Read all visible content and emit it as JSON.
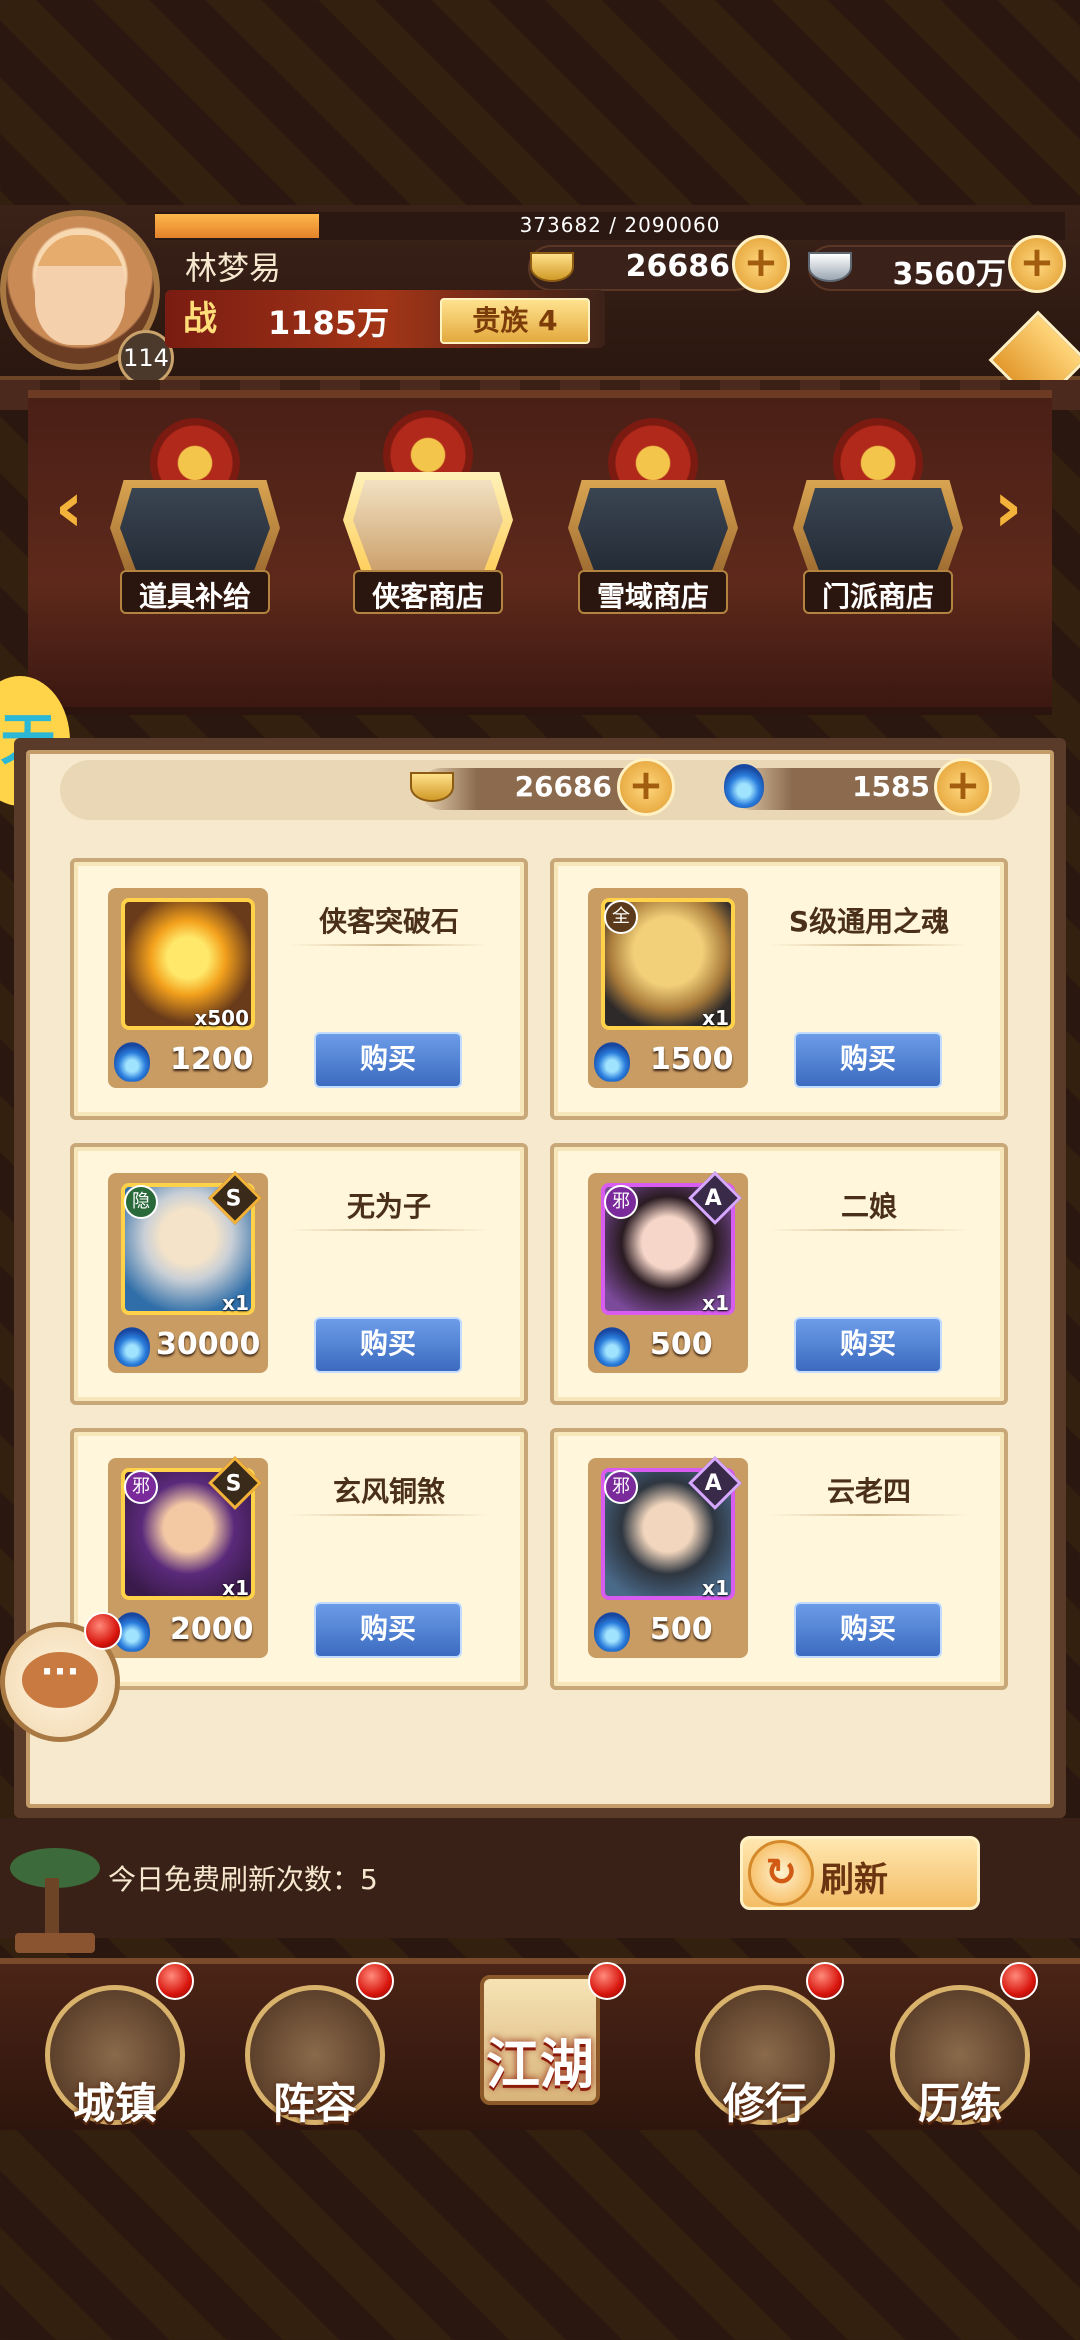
{
  "player": {
    "name": "林梦易",
    "level": "114",
    "exp_text": "373682 / 2090060",
    "exp_progress": 0.18,
    "power_icon_label": "战",
    "power": "1185万",
    "noble_label": "贵族 4"
  },
  "currencies": {
    "gold": "26686",
    "silver": "3560万"
  },
  "shop_tabs": [
    {
      "label": "道具补给",
      "active": false
    },
    {
      "label": "侠客商店",
      "active": true
    },
    {
      "label": "雪域商店",
      "active": false
    },
    {
      "label": "门派商店",
      "active": false
    }
  ],
  "shop_resources": {
    "gold": "26686",
    "soul": "1585"
  },
  "items": [
    {
      "name": "侠客突破石",
      "qty": "x500",
      "price": "1200",
      "buy": "购买",
      "tag": "",
      "grade": "",
      "border": "gold"
    },
    {
      "name": "S级通用之魂",
      "qty": "x1",
      "price": "1500",
      "buy": "购买",
      "tag": "全",
      "grade": "",
      "border": "gold"
    },
    {
      "name": "无为子",
      "qty": "x1",
      "price": "30000",
      "buy": "购买",
      "tag": "隐",
      "grade": "S",
      "border": "gold"
    },
    {
      "name": "二娘",
      "qty": "x1",
      "price": "500",
      "buy": "购买",
      "tag": "邪",
      "grade": "A",
      "border": "purple"
    },
    {
      "name": "玄风铜煞",
      "qty": "x1",
      "price": "2000",
      "buy": "购买",
      "tag": "邪",
      "grade": "S",
      "border": "gold"
    },
    {
      "name": "云老四",
      "qty": "x1",
      "price": "500",
      "buy": "购买",
      "tag": "邪",
      "grade": "A",
      "border": "purple"
    }
  ],
  "refresh": {
    "free_text": "今日免费刷新次数：5",
    "button_label": "刷新"
  },
  "nav": [
    {
      "label": "城镇"
    },
    {
      "label": "阵容"
    },
    {
      "label": "江湖"
    },
    {
      "label": "修行"
    },
    {
      "label": "历练"
    }
  ],
  "icons": {
    "refresh": "↻",
    "chat": "···",
    "plus": "+",
    "arrow_left": "‹",
    "arrow_right": "›"
  },
  "colors": {
    "buy_button": "#4a7ad0",
    "gold_accent": "#f3b33a",
    "notification": "#d8150d"
  }
}
